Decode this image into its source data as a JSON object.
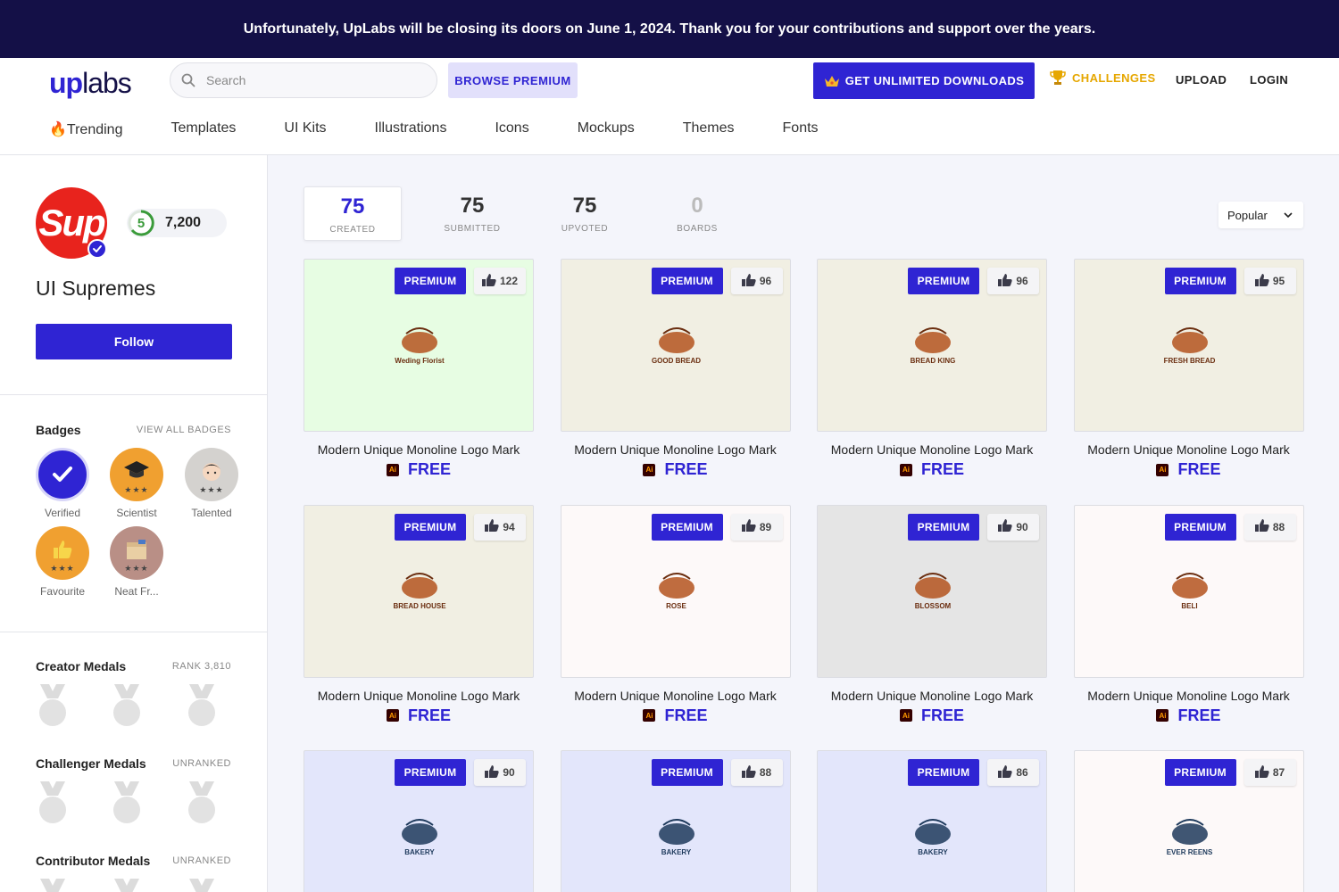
{
  "banner": {
    "text": "Unfortunately, UpLabs will be closing its doors on June 1, 2024. Thank you for your contributions and support over the years."
  },
  "header": {
    "logo_up": "up",
    "logo_labs": "labs",
    "search_placeholder": "Search",
    "browse_premium": "BROWSE PREMIUM",
    "get_unlimited": "GET UNLIMITED DOWNLOADS",
    "challenges": "CHALLENGES",
    "upload": "UPLOAD",
    "login": "LOGIN"
  },
  "nav": {
    "items": [
      "🔥Trending",
      "Templates",
      "UI Kits",
      "Illustrations",
      "Icons",
      "Mockups",
      "Themes",
      "Fonts"
    ]
  },
  "profile": {
    "avatar_text": "Sup",
    "level": "5",
    "points": "7,200",
    "name": "UI Supremes",
    "follow": "Follow"
  },
  "badges": {
    "title": "Badges",
    "view_all": "VIEW ALL BADGES",
    "items": [
      {
        "label": "Verified",
        "icon": "check-icon",
        "color": "#2f24d3"
      },
      {
        "label": "Scientist",
        "icon": "graduation-cap-icon",
        "color": "#f0a030",
        "stars": "★★★"
      },
      {
        "label": "Talented",
        "icon": "face-icon",
        "color": "#cfcfcf",
        "stars": "★★★"
      },
      {
        "label": "Favourite",
        "icon": "thumbs-up-icon",
        "color": "#f0a030",
        "stars": "★★★"
      },
      {
        "label": "Neat Fr...",
        "icon": "box-icon",
        "color": "#b98f86",
        "stars": "★★★"
      }
    ]
  },
  "medals": {
    "creator": {
      "title": "Creator Medals",
      "rank": "RANK 3,810"
    },
    "challenger": {
      "title": "Challenger Medals",
      "rank": "UNRANKED"
    },
    "contributor": {
      "title": "Contributor Medals",
      "rank": "UNRANKED"
    }
  },
  "stats": {
    "created": {
      "value": "75",
      "label": "CREATED"
    },
    "submitted": {
      "value": "75",
      "label": "SUBMITTED"
    },
    "upvoted": {
      "value": "75",
      "label": "UPVOTED"
    },
    "boards": {
      "value": "0",
      "label": "BOARDS"
    }
  },
  "sort": {
    "selected": "Popular"
  },
  "cards": [
    {
      "title": "Modern Unique Monoline Logo Mark",
      "price": "FREE",
      "premium": "PREMIUM",
      "likes": "122",
      "bg": "#e7fde3",
      "art": "Weding Florist"
    },
    {
      "title": "Modern Unique Monoline Logo Mark",
      "price": "FREE",
      "premium": "PREMIUM",
      "likes": "96",
      "bg": "#f1efe3",
      "art": "GOOD BREAD"
    },
    {
      "title": "Modern Unique Monoline Logo Mark",
      "price": "FREE",
      "premium": "PREMIUM",
      "likes": "96",
      "bg": "#f1efe3",
      "art": "BREAD KING"
    },
    {
      "title": "Modern Unique Monoline Logo Mark",
      "price": "FREE",
      "premium": "PREMIUM",
      "likes": "95",
      "bg": "#f1efe3",
      "art": "FRESH BREAD"
    },
    {
      "title": "Modern Unique Monoline Logo Mark",
      "price": "FREE",
      "premium": "PREMIUM",
      "likes": "94",
      "bg": "#f1efe3",
      "art": "BREAD HOUSE"
    },
    {
      "title": "Modern Unique Monoline Logo Mark",
      "price": "FREE",
      "premium": "PREMIUM",
      "likes": "89",
      "bg": "#fdf9f9",
      "art": "ROSE"
    },
    {
      "title": "Modern Unique Monoline Logo Mark",
      "price": "FREE",
      "premium": "PREMIUM",
      "likes": "90",
      "bg": "#e5e5e5",
      "art": "BLOSSOM"
    },
    {
      "title": "Modern Unique Monoline Logo Mark",
      "price": "FREE",
      "premium": "PREMIUM",
      "likes": "88",
      "bg": "#fdf9f9",
      "art": "BELI"
    },
    {
      "title": "",
      "price": "",
      "premium": "PREMIUM",
      "likes": "90",
      "bg": "#e3e6fb",
      "art": "BAKERY"
    },
    {
      "title": "",
      "price": "",
      "premium": "PREMIUM",
      "likes": "88",
      "bg": "#e3e6fb",
      "art": "BAKERY"
    },
    {
      "title": "",
      "price": "",
      "premium": "PREMIUM",
      "likes": "86",
      "bg": "#e3e6fb",
      "art": "BAKERY"
    },
    {
      "title": "",
      "price": "",
      "premium": "PREMIUM",
      "likes": "87",
      "bg": "#fdf9f9",
      "art": "EVER REENS"
    }
  ]
}
